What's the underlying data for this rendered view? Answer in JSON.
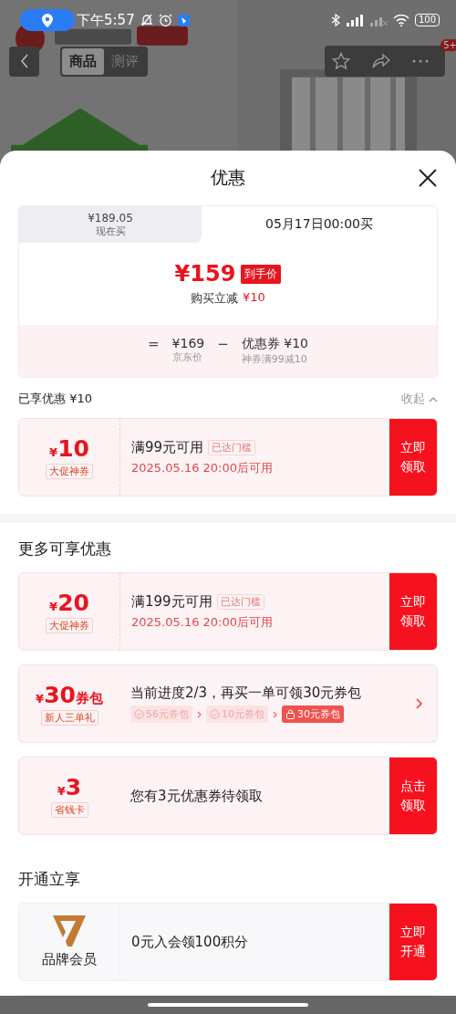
{
  "status_bar": {
    "time": "下午5:57",
    "battery": "100"
  },
  "product_page": {
    "tabs": [
      {
        "label": "商品",
        "selected": true
      },
      {
        "label": "测评",
        "selected": false
      }
    ],
    "more_badge": "5+"
  },
  "sheet": {
    "title": "优惠"
  },
  "price_card": {
    "options": [
      {
        "price": "¥189.05",
        "label": "现在买",
        "selected": false
      },
      {
        "price": "05月17日00:00买",
        "selected": true
      }
    ],
    "final_price": "¥159",
    "final_tag": "到手价",
    "reduce_label": "购买立减",
    "reduce_amount": "¥10",
    "formula": {
      "equals": "=",
      "base_price": "¥169",
      "base_label": "京东价",
      "minus": "−",
      "coupon_price": "优惠券 ¥10",
      "coupon_label": "神券满99减10"
    }
  },
  "enjoyed": {
    "label": "已享优惠 ¥10",
    "toggle": "收起",
    "expanded": true
  },
  "enjoyed_coupons": [
    {
      "kind": "coupon",
      "currency": "¥",
      "amount": "10",
      "tag": "大促神券",
      "title": "满99元可用",
      "threshold": "已达门槛",
      "date": "2025.05.16 20:00后可用",
      "button": "立即领取"
    }
  ],
  "more_title": "更多可享优惠",
  "more_coupons": [
    {
      "kind": "coupon",
      "currency": "¥",
      "amount": "20",
      "tag": "大促神券",
      "title": "满199元可用",
      "threshold": "已达门槛",
      "date": "2025.05.16 20:00后可用",
      "button": "立即领取"
    },
    {
      "kind": "pack",
      "currency": "¥",
      "amount": "30",
      "unit": "券包",
      "tag": "新人三单礼",
      "title": "当前进度2/3，再买一单可领30元券包",
      "steps": [
        {
          "label": "56元券包",
          "done": true
        },
        {
          "label": "10元券包",
          "done": true
        },
        {
          "label": "30元券包",
          "done": false
        }
      ]
    },
    {
      "kind": "card",
      "currency": "¥",
      "amount": "3",
      "tag": "省钱卡",
      "title": "您有3元优惠券待领取",
      "button": "点击领取"
    }
  ],
  "open_title": "开通立享",
  "member": {
    "name": "品牌会员",
    "title": "0元入会领100积分",
    "button": "立即开通"
  }
}
